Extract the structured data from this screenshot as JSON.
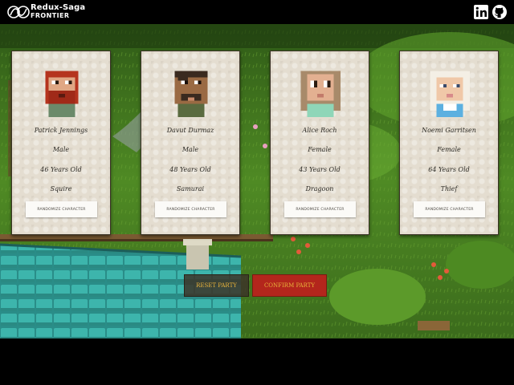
{
  "header": {
    "brand_line1": "Redux-Saga",
    "brand_line2": "FRONTIER",
    "logo_icon": "redux-saga-logo-icon",
    "social": [
      "linkedin-icon",
      "github-icon"
    ]
  },
  "party": [
    {
      "name": "Patrick Jennings",
      "gender": "Male",
      "age": "46 Years Old",
      "class": "Squire",
      "randomize_label": "RANDOMIZE CHARACTER",
      "hair": "#b5341e",
      "skin": "#e0a784",
      "shirt": "#6b8a6a"
    },
    {
      "name": "Davut Durmaz",
      "gender": "Male",
      "age": "48 Years Old",
      "class": "Samurai",
      "randomize_label": "RANDOMIZE CHARACTER",
      "hair": "#3a2a1f",
      "skin": "#9a6a43",
      "shirt": "#5a6b3f"
    },
    {
      "name": "Alice Roch",
      "gender": "Female",
      "age": "43 Years Old",
      "class": "Dragoon",
      "randomize_label": "RANDOMIZE CHARACTER",
      "hair": "#a88a6a",
      "skin": "#e3b091",
      "shirt": "#8fd6b8"
    },
    {
      "name": "Noemi Garritsen",
      "gender": "Female",
      "age": "64 Years Old",
      "class": "Thief",
      "randomize_label": "RANDOMIZE CHARACTER",
      "hair": "#f4efe5",
      "skin": "#f0c8a8",
      "shirt": "#5cb0e0"
    }
  ],
  "actions": {
    "reset_label": "RESET PARTY",
    "confirm_label": "CONFIRM PARTY"
  },
  "colors": {
    "confirm": "#b3261c",
    "button_text": "#e8b23a"
  }
}
